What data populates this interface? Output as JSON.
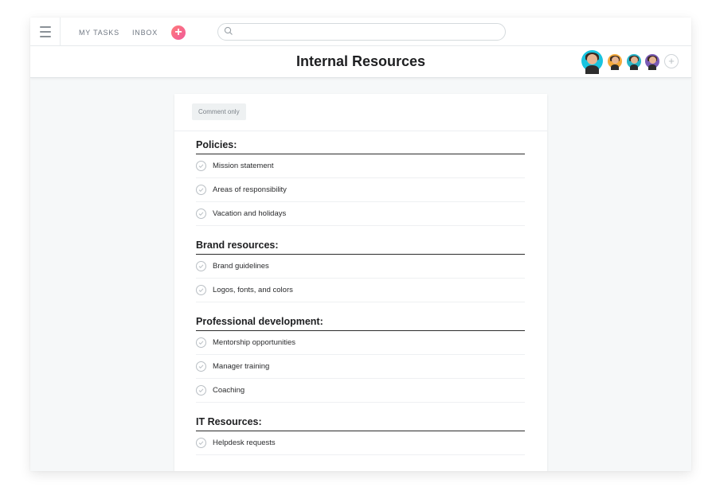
{
  "topbar": {
    "nav": [
      {
        "label": "MY TASKS"
      },
      {
        "label": "INBOX"
      }
    ],
    "add_label": "+",
    "search": {
      "placeholder": ""
    }
  },
  "header": {
    "title": "Internal Resources",
    "add_member_label": "+"
  },
  "document": {
    "permission_badge": "Comment only",
    "sections": [
      {
        "heading": "Policies:",
        "tasks": [
          "Mission statement",
          "Areas of responsibility",
          "Vacation and holidays"
        ]
      },
      {
        "heading": "Brand resources:",
        "tasks": [
          "Brand guidelines",
          "Logos, fonts, and colors"
        ]
      },
      {
        "heading": "Professional development:",
        "tasks": [
          "Mentorship opportunities",
          "Manager training",
          "Coaching"
        ]
      },
      {
        "heading": "IT Resources:",
        "tasks": [
          "Helpdesk requests"
        ]
      }
    ]
  },
  "colors": {
    "accent": "#f05a9a",
    "background": "#f6f8f9"
  }
}
